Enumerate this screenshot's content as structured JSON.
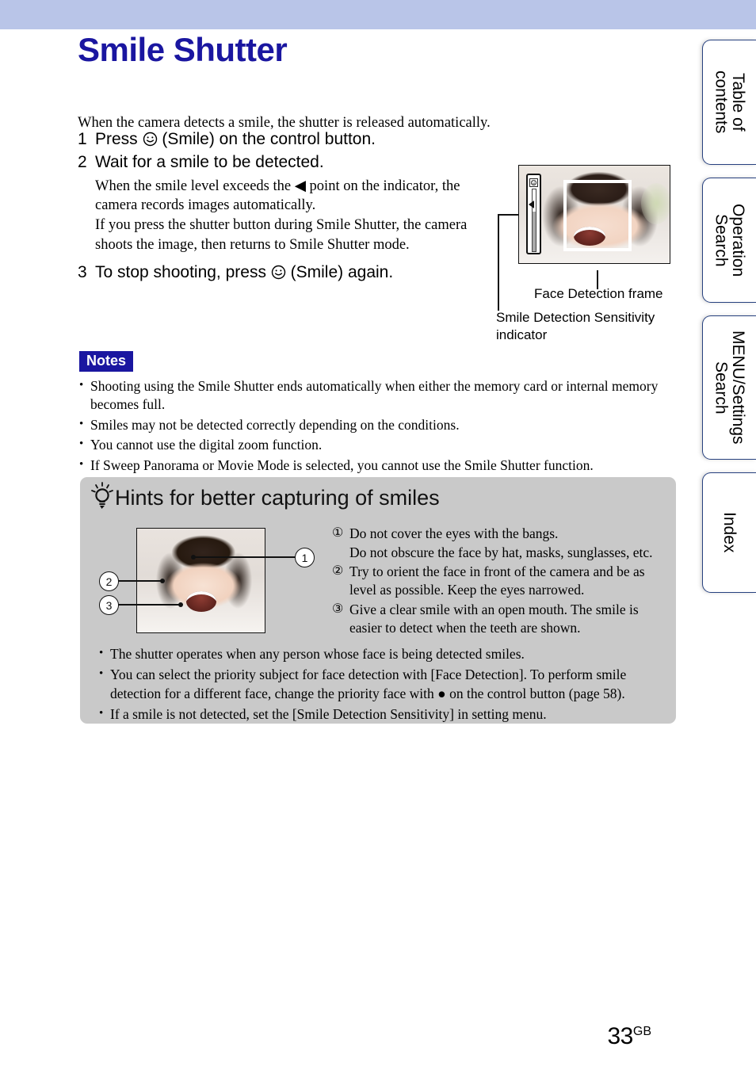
{
  "header": {
    "band_color": "#b9c5e8"
  },
  "page_title": "Smile Shutter",
  "intro": "When the camera detects a smile, the shutter is released automatically.",
  "steps": [
    {
      "num": "1",
      "text_before_icon": "Press ",
      "icon": "smile-icon",
      "text_after_icon": " (Smile) on the control button.",
      "sub": ""
    },
    {
      "num": "2",
      "text_before_icon": "Wait for a smile to be detected.",
      "icon": "",
      "text_after_icon": "",
      "sub_line_1": "When the smile level exceeds the ◀ point on the indicator, the camera records images automatically.",
      "sub_line_2": "If you press the shutter button during Smile Shutter, the camera shoots the image, then returns to Smile Shutter mode."
    },
    {
      "num": "3",
      "text_before_icon": "To stop shooting, press ",
      "icon": "smile-icon",
      "text_after_icon": " (Smile) again.",
      "sub": ""
    }
  ],
  "figure": {
    "face_frame_caption": "Face Detection frame",
    "sensitivity_caption_line1": "Smile Detection Sensitivity",
    "sensitivity_caption_line2": "indicator"
  },
  "notes": {
    "badge": "Notes",
    "badge_bg": "#1a16a0",
    "items": [
      "Shooting using the Smile Shutter ends automatically when either the memory card or internal memory becomes full.",
      "Smiles may not be detected correctly depending on the conditions.",
      "You cannot use the digital zoom function.",
      "If Sweep Panorama or Movie Mode is selected, you cannot use the Smile Shutter function."
    ]
  },
  "hints": {
    "title": "Hints for better capturing of smiles",
    "bg_color": "#c9c9c9",
    "callouts": [
      "1",
      "2",
      "3"
    ],
    "numbered": [
      {
        "num": "①",
        "line1": "Do not cover the eyes with the bangs.",
        "line2": "Do not obscure the face by hat, masks, sunglasses, etc."
      },
      {
        "num": "②",
        "line1": "Try to orient the face in front of the camera and be as level as possible. Keep the eyes narrowed.",
        "line2": ""
      },
      {
        "num": "③",
        "line1": "Give a clear smile with an open mouth. The smile is easier to detect when the teeth are shown.",
        "line2": ""
      }
    ],
    "bullets": [
      "The shutter operates when any person whose face is being detected smiles.",
      "You can select the priority subject for face detection with [Face Detection]. To perform smile detection for a different face, change the priority face with ● on the control button (page 58).",
      "If a smile is not detected, set the [Smile Detection Sensitivity] in setting menu."
    ]
  },
  "tabs": [
    {
      "label": "Table of\ncontents"
    },
    {
      "label": "Operation\nSearch"
    },
    {
      "label": "MENU/Settings\nSearch"
    },
    {
      "label": "Index"
    }
  ],
  "footer": {
    "page_number": "33",
    "page_suffix": "GB"
  }
}
